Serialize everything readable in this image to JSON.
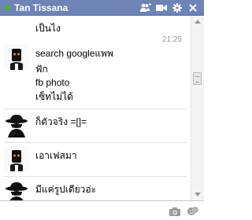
{
  "window": {
    "title": "Tan Tissana",
    "status": "online",
    "status_color": "#42b72a",
    "header_color": "#6d84b4"
  },
  "toolbar_icons": [
    "add-friends-icon",
    "video-call-icon",
    "settings-gear-icon",
    "close-icon"
  ],
  "conversation": {
    "first_message": "เป็นไง",
    "timestamp": "21:25",
    "groups": [
      {
        "sender_avatar": "masked-face-avatar",
        "lines": [
          "search googleแพพ",
          "ฟัก",
          "fb photo",
          "เซ็ทไม่ได้"
        ]
      },
      {
        "sender_avatar": "spy-hat-avatar",
        "lines": [
          "ก็ตัวจริง =[]="
        ]
      },
      {
        "sender_avatar": "masked-face-avatar",
        "lines": [
          "เอาเฟสมา"
        ]
      },
      {
        "sender_avatar": "spy-hat-avatar",
        "lines": [
          "มีแค่รูปเดียวอ่ะ"
        ]
      }
    ]
  },
  "composer": {
    "value": "",
    "placeholder": "",
    "icons": [
      "camera-icon",
      "emoticon-icon"
    ]
  }
}
